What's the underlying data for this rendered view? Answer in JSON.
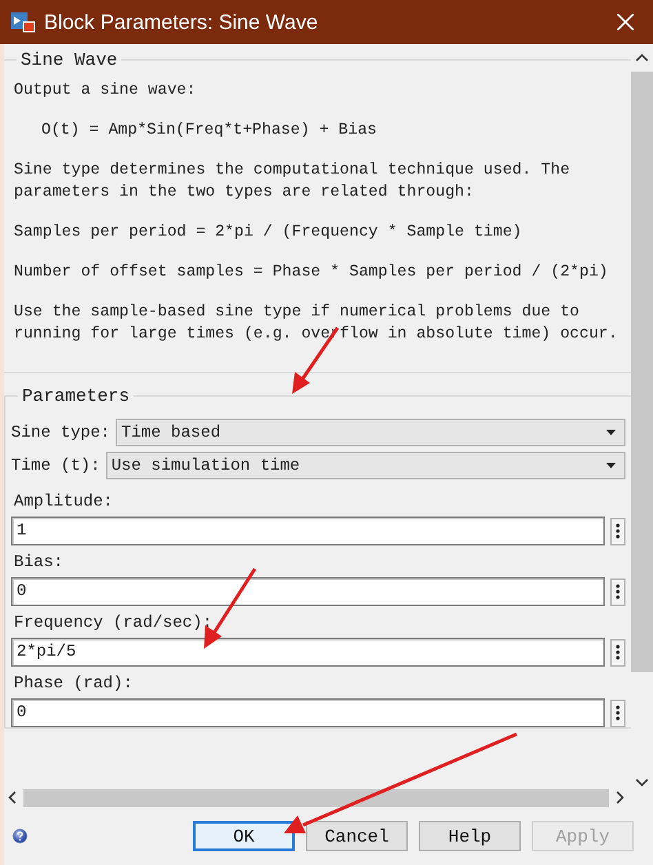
{
  "window": {
    "title": "Block Parameters: Sine Wave"
  },
  "description": {
    "title": "Sine Wave",
    "paragraphs": [
      {
        "kind": "text",
        "text": "Output a sine wave:"
      },
      {
        "kind": "formula",
        "text": "O(t) = Amp*Sin(Freq*t+Phase) + Bias"
      },
      {
        "kind": "text",
        "text": "Sine type determines the computational technique used. The parameters in the two types are related through:"
      },
      {
        "kind": "text",
        "text": "Samples per period = 2*pi / (Frequency * Sample time)"
      },
      {
        "kind": "text",
        "text": "Number of offset samples = Phase * Samples per period / (2*pi)"
      },
      {
        "kind": "text",
        "text": "Use the sample-based sine type if numerical problems due to running for large times (e.g. overflow in absolute time) occur."
      }
    ]
  },
  "parameters": {
    "title": "Parameters",
    "items": [
      {
        "kind": "dropdown",
        "label": "Sine type:",
        "value": "Time based"
      },
      {
        "kind": "dropdown",
        "label": "Time (t):",
        "value": "Use simulation time"
      },
      {
        "kind": "field",
        "label": "Amplitude:",
        "value": "1"
      },
      {
        "kind": "field",
        "label": "Bias:",
        "value": "0"
      },
      {
        "kind": "field",
        "label": "Frequency (rad/sec):",
        "value": "2*pi/5"
      },
      {
        "kind": "field",
        "label": "Phase (rad):",
        "value": "0"
      }
    ]
  },
  "buttons": [
    {
      "label": "OK",
      "focused": true,
      "disabled": false
    },
    {
      "label": "Cancel",
      "focused": false,
      "disabled": false
    },
    {
      "label": "Help",
      "focused": false,
      "disabled": false
    },
    {
      "label": "Apply",
      "focused": false,
      "disabled": true
    }
  ]
}
